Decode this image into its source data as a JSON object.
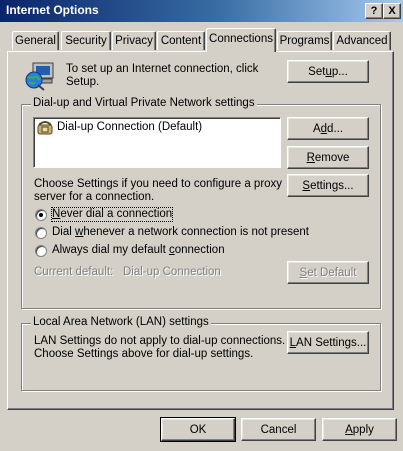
{
  "window": {
    "title": "Internet Options",
    "help_glyph": "?",
    "close_glyph": "X"
  },
  "tabs": [
    {
      "label": "General"
    },
    {
      "label": "Security"
    },
    {
      "label": "Privacy"
    },
    {
      "label": "Content"
    },
    {
      "label": "Connections"
    },
    {
      "label": "Programs"
    },
    {
      "label": "Advanced"
    }
  ],
  "active_tab": "Connections",
  "setup": {
    "text_line1": "To set up an Internet connection, click",
    "text_line2": "Setup.",
    "button": "Setup..."
  },
  "dialup": {
    "legend": "Dial-up and Virtual Private Network settings",
    "connections": [
      {
        "name": "Dial-up Connection (Default)"
      }
    ],
    "add_button": "Add...",
    "remove_button": "Remove",
    "settings_button": "Settings...",
    "info_line1": "Choose Settings if you need to configure a proxy",
    "info_line2": "server for a connection.",
    "options": [
      {
        "label": "Never dial a connection",
        "selected": true
      },
      {
        "label": "Dial whenever a network connection is not present",
        "selected": false
      },
      {
        "label": "Always dial my default connection",
        "selected": false
      }
    ],
    "current_default_label": "Current default:",
    "current_default_value": "Dial-up Connection",
    "set_default_button": "Set Default"
  },
  "lan": {
    "legend": "Local Area Network (LAN) settings",
    "info_line1": "LAN Settings do not apply to dial-up connections.",
    "info_line2": "Choose Settings above for dial-up settings.",
    "button": "LAN Settings..."
  },
  "footer": {
    "ok": "OK",
    "cancel": "Cancel",
    "apply": "Apply"
  },
  "colors": {
    "face": "#d4d0c8",
    "title_start": "#0a246a",
    "title_end": "#a6caf0"
  },
  "icons": {
    "setup": "globe-computer-icon",
    "connection": "dialup-phone-icon"
  }
}
